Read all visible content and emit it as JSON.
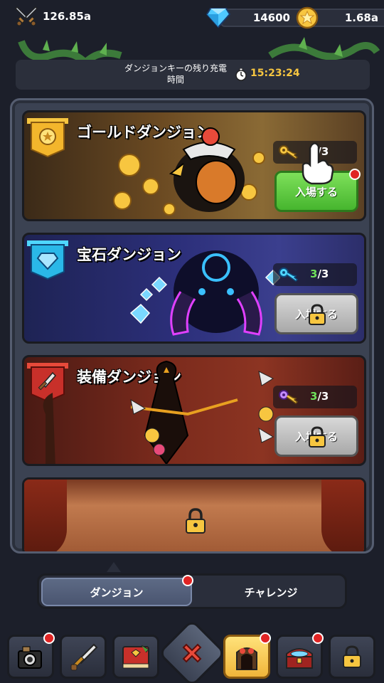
{
  "top": {
    "power": "126.85a",
    "gems": "14600",
    "gold": "1.68a"
  },
  "timer": {
    "label": "ダンジョンキーの残り充電時間",
    "value": "15:23:24"
  },
  "dungeons": [
    {
      "title": "ゴールドダンジョン",
      "keys": "3",
      "keys_max": "/3",
      "button": "入場する",
      "state": "enter"
    },
    {
      "title": "宝石ダンジョン",
      "keys": "3",
      "keys_max": "/3",
      "button": "入場する",
      "state": "locked"
    },
    {
      "title": "装備ダンジョン",
      "keys": "3",
      "keys_max": "/3",
      "button": "入場する",
      "state": "locked"
    }
  ],
  "tabs": {
    "dungeon": "ダンジョン",
    "challenge": "チャレンジ"
  },
  "colors": {
    "accent_gold": "#f7c640",
    "green_button": "#46b52e",
    "key_count_green": "#6ee05a",
    "red_dot": "#e02424"
  },
  "icons": [
    "swords-icon",
    "gem-icon",
    "coin-icon",
    "clock-icon",
    "key-icon",
    "lock-icon",
    "hand-pointer-icon",
    "camera-icon",
    "sword-icon",
    "book-icon",
    "close-icon",
    "dungeon-icon",
    "treasure-chest-icon"
  ]
}
